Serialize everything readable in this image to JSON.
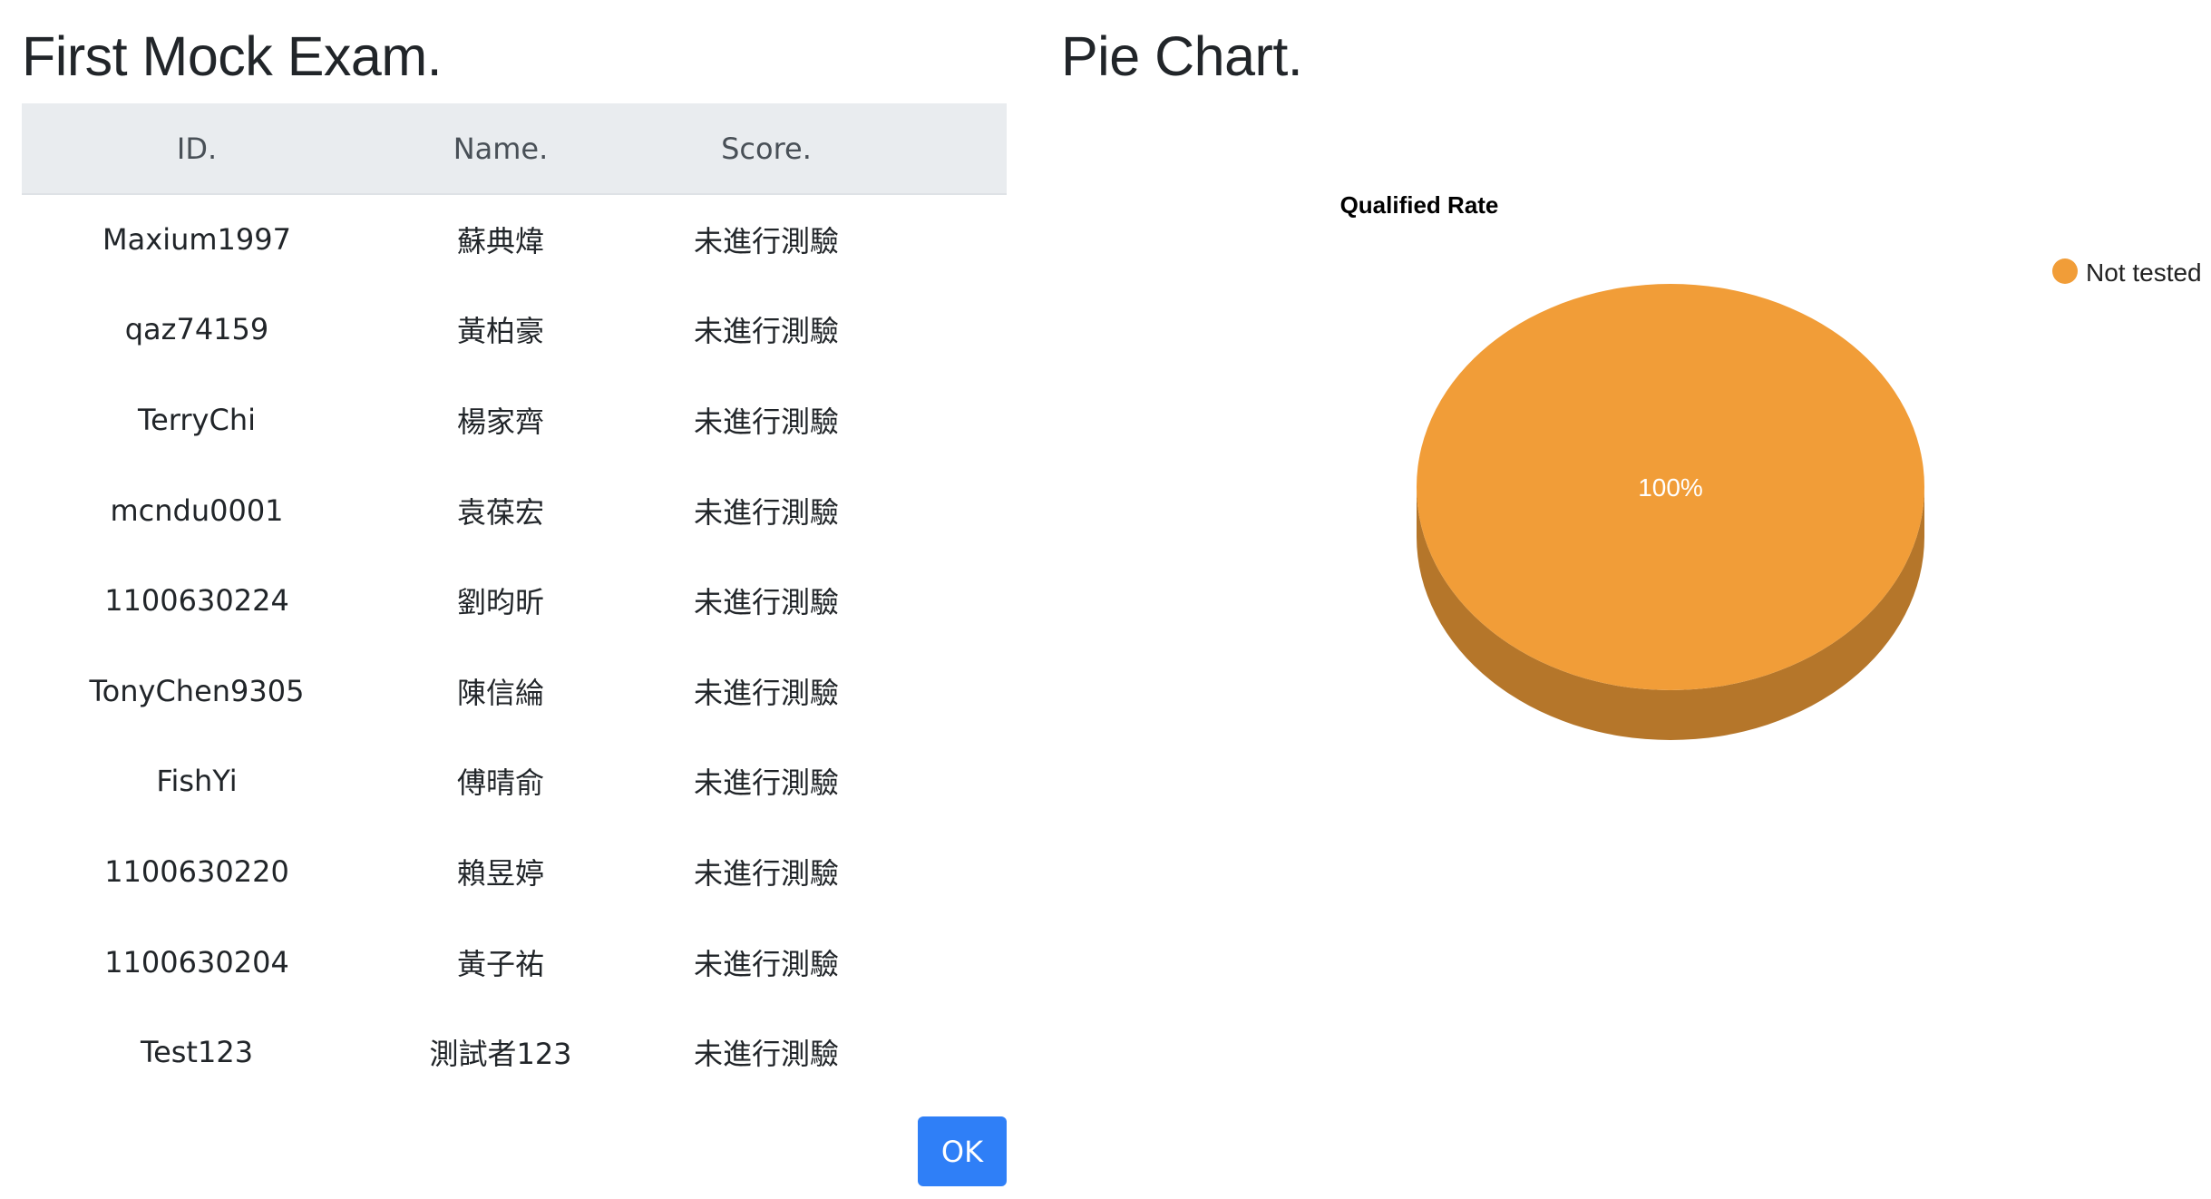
{
  "left": {
    "title": "First Mock Exam.",
    "table": {
      "headers": [
        "ID.",
        "Name.",
        "Score."
      ],
      "rows": [
        [
          "Maxium1997",
          "蘇典煒",
          "未進行測驗"
        ],
        [
          "qaz74159",
          "黃柏豪",
          "未進行測驗"
        ],
        [
          "TerryChi",
          "楊家齊",
          "未進行測驗"
        ],
        [
          "mcndu0001",
          "袁葆宏",
          "未進行測驗"
        ],
        [
          "1100630224",
          "劉昀昕",
          "未進行測驗"
        ],
        [
          "TonyChen9305",
          "陳信綸",
          "未進行測驗"
        ],
        [
          "FishYi",
          "傅晴俞",
          "未進行測驗"
        ],
        [
          "1100630220",
          "賴昱婷",
          "未進行測驗"
        ],
        [
          "1100630204",
          "黃子祐",
          "未進行測驗"
        ],
        [
          "Test123",
          "測試者123",
          "未進行測驗"
        ]
      ]
    },
    "ok_button": "OK"
  },
  "right": {
    "title": "Pie Chart."
  },
  "colors": {
    "accent_button": "#2f7ff7",
    "table_header_bg": "#e9ecef",
    "slice_not_tested": "#f19d38",
    "slice_not_tested_side": "#b5762a"
  },
  "chart_data": {
    "type": "pie",
    "title": "Qualified Rate",
    "three_d": true,
    "legend_position": "top-right",
    "categories": [
      "Not tested"
    ],
    "values": [
      100
    ],
    "data_labels": [
      "100%"
    ],
    "colors": [
      "#f19d38"
    ]
  }
}
